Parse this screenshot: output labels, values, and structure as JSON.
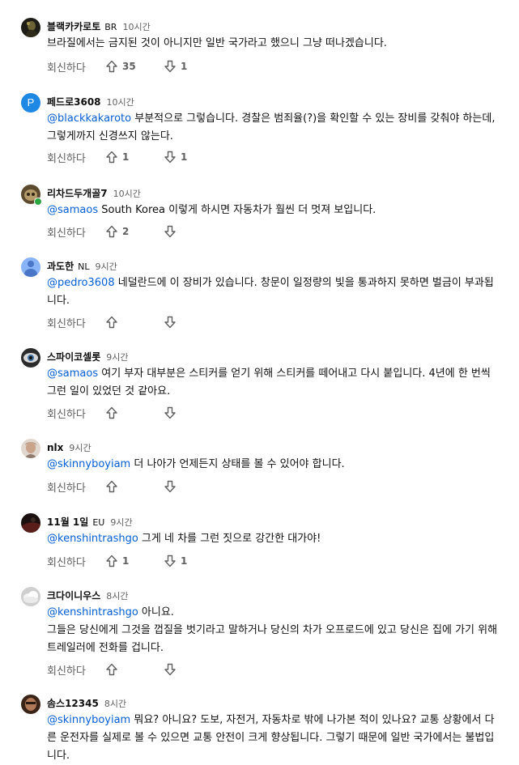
{
  "comments": [
    {
      "author": "블랙카카로토",
      "country": "BR",
      "time": "10시간",
      "mention": "",
      "text": "브라질에서는 금지된 것이 아니지만 일반 국가라고 했으니 그냥 떠나겠습니다.",
      "reply": "회신하다",
      "likes": "35",
      "dislikes": "1",
      "avatar": "dark-figure-avatar"
    },
    {
      "author": "페드로3608",
      "country": "",
      "time": "10시간",
      "mention": "@blackkakaroto",
      "text": " 부분적으로 그렇습니다. 경찰은 범죄율(?)을 확인할 수 있는 장비를 갖춰야 하는데, 그렇게까지 신경쓰지 않는다.",
      "reply": "회신하다",
      "likes": "1",
      "dislikes": "1",
      "avatar": "letter-avatar",
      "letter": "P"
    },
    {
      "author": "리차드두개골7",
      "country": "",
      "time": "10시간",
      "mention": "@samaos",
      "text": " South Korea 이렇게 하시면 자동차가 훨씬 더 멋져 보입니다.",
      "reply": "회신하다",
      "likes": "2",
      "dislikes": "",
      "avatar": "skull-avatar"
    },
    {
      "author": "과도한",
      "country": "NL",
      "time": "9시간",
      "mention": "@pedro3608",
      "text": " 네덜란드에 이 장비가 있습니다. 창문이 일정량의 빛을 통과하지 못하면 벌금이 부과됩니다.",
      "reply": "회신하다",
      "likes": "",
      "dislikes": "",
      "avatar": "default-user-avatar"
    },
    {
      "author": "스파이코셀롯",
      "country": "",
      "time": "9시간",
      "mention": "@samaos",
      "text": " 여기 부자 대부분은 스티커를 얻기 위해 스티커를 떼어내고 다시 붙입니다. 4년에 한 번씩 그런 일이 있었던 것 같아요.",
      "reply": "회신하다",
      "likes": "",
      "dislikes": "",
      "avatar": "eye-avatar"
    },
    {
      "author": "nlx",
      "country": "",
      "time": "9시간",
      "mention": "@skinnyboyiam",
      "text": " 더 나아가 언제든지 상태를 볼 수 있어야 합니다.",
      "reply": "회신하다",
      "likes": "",
      "dislikes": "",
      "avatar": "portrait-avatar"
    },
    {
      "author": "11월 1일",
      "country": "EU",
      "time": "9시간",
      "mention": "@kenshintrashgo",
      "text": " 그게 네 차를 그런 짓으로 강간한 대가야!",
      "reply": "회신하다",
      "likes": "1",
      "dislikes": "1",
      "avatar": "dark-red-avatar"
    },
    {
      "author": "크다이니우스",
      "country": "",
      "time": "8시간",
      "mention": "@kenshintrashgo",
      "text": " 아니요.\n그들은 당신에게 그것을 껍질을 벗기라고 말하거나 당신의 차가 오프로드에 있고 당신은 집에 가기 위해 트레일러에 전화를 겁니다.",
      "reply": "회신하다",
      "likes": "",
      "dislikes": "",
      "avatar": "cloud-avatar"
    },
    {
      "author": "솜스12345",
      "country": "",
      "time": "8시간",
      "mention": "@skinnyboyiam",
      "text": " 뭐요? 아니요? 도보, 자전거, 자동차로 밖에 나가본 적이 있나요? 교통 상황에서 다른 운전자를 실제로 볼 수 있으면 교통 안전이 크게 향상됩니다. 그렇기 때문에 일반 국가에서는 불법입니다.",
      "reply": "",
      "likes": "",
      "dislikes": "",
      "avatar": "face-avatar"
    }
  ]
}
